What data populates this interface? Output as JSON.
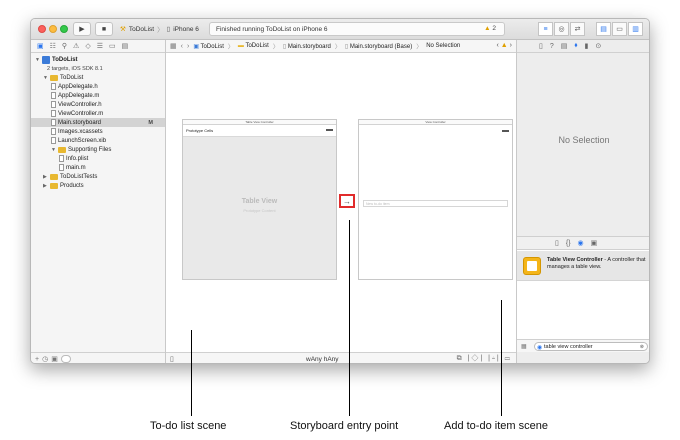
{
  "toolbar": {
    "run_icon": "play-icon",
    "stop_icon": "stop-icon",
    "scheme": "ToDoList",
    "device": "iPhone 6",
    "status_text": "Finished running ToDoList on iPhone 6",
    "warning_count": "2"
  },
  "navigator": {
    "items": [
      {
        "label": "ToDoList",
        "kind": "project",
        "level": 0,
        "bold": true
      },
      {
        "label": "2 targets, iOS SDK 8.1",
        "kind": "subtitle",
        "level": 1
      },
      {
        "label": "ToDoList",
        "kind": "folder",
        "level": 1
      },
      {
        "label": "AppDelegate.h",
        "kind": "file",
        "level": 2
      },
      {
        "label": "AppDelegate.m",
        "kind": "file",
        "level": 2
      },
      {
        "label": "ViewController.h",
        "kind": "file",
        "level": 2
      },
      {
        "label": "ViewController.m",
        "kind": "file",
        "level": 2
      },
      {
        "label": "Main.storyboard",
        "kind": "file",
        "level": 2,
        "selected": true,
        "badge": "M"
      },
      {
        "label": "Images.xcassets",
        "kind": "file",
        "level": 2
      },
      {
        "label": "LaunchScreen.xib",
        "kind": "file",
        "level": 2
      },
      {
        "label": "Supporting Files",
        "kind": "folder",
        "level": 2
      },
      {
        "label": "Info.plist",
        "kind": "file",
        "level": 3
      },
      {
        "label": "main.m",
        "kind": "file",
        "level": 3
      },
      {
        "label": "ToDoListTests",
        "kind": "folder",
        "level": 1
      },
      {
        "label": "Products",
        "kind": "folder",
        "level": 1
      }
    ]
  },
  "jumpbar": {
    "crumbs": [
      "ToDoList",
      "ToDoList",
      "Main.storyboard",
      "Main.storyboard (Base)",
      "No Selection"
    ],
    "warning_count": "1"
  },
  "canvas": {
    "scene1": {
      "title": "Table View Controller",
      "section": "Prototype Cells",
      "placeholder": "Table View",
      "placeholder_sub": "Prototype Content"
    },
    "scene2": {
      "title": "View Controller",
      "field_placeholder": "New to-do item"
    },
    "size_class": "wAny hAny"
  },
  "inspector": {
    "empty_text": "No Selection",
    "library_item_title": "Table View Controller",
    "library_item_desc": " - A controller that manages a table view.",
    "filter_text": "table view controller"
  },
  "annotations": {
    "left": "To-do list scene",
    "center": "Storyboard entry point",
    "right": "Add to-do item scene"
  }
}
